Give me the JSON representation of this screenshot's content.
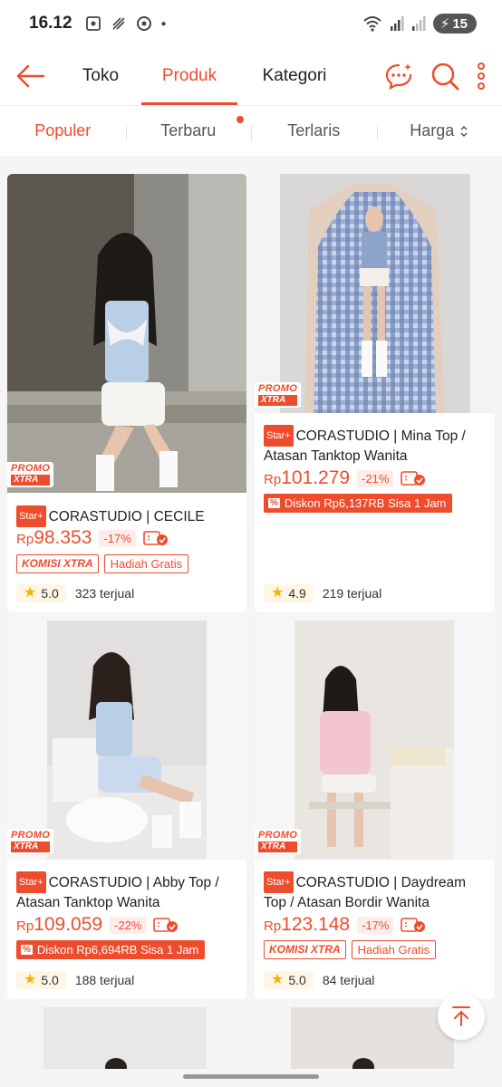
{
  "status_bar": {
    "time": "16.12",
    "battery": "15"
  },
  "header": {
    "tabs": [
      {
        "label": "Toko"
      },
      {
        "label": "Produk"
      },
      {
        "label": "Kategori"
      }
    ]
  },
  "sort_bar": {
    "items": [
      {
        "label": "Populer"
      },
      {
        "label": "Terbaru"
      },
      {
        "label": "Terlaris"
      },
      {
        "label": "Harga"
      }
    ]
  },
  "products": [
    {
      "badge": "Star+",
      "title": "CORASTUDIO | CECILE",
      "currency": "Rp",
      "price": "98.353",
      "discount": "-17%",
      "komisi": "KOMISI XTRA",
      "hadiah": "Hadiah Gratis",
      "rating": "5.0",
      "sold": "323 terjual",
      "promo_top": "PROMO",
      "promo_bottom": "XTRA"
    },
    {
      "badge": "Star+",
      "title": "CORASTUDIO | Mina Top / Atasan Tanktop Wanita",
      "currency": "Rp",
      "price": "101.279",
      "discount": "-21%",
      "diskon_label": "Diskon Rp6,137RB Sisa 1 Jam",
      "rating": "4.9",
      "sold": "219 terjual",
      "promo_top": "PROMO",
      "promo_bottom": "XTRA"
    },
    {
      "badge": "Star+",
      "title": "CORASTUDIO | Abby Top / Atasan Tanktop Wanita",
      "currency": "Rp",
      "price": "109.059",
      "discount": "-22%",
      "diskon_label": "Diskon Rp6,694RB Sisa 1 Jam",
      "rating": "5.0",
      "sold": "188 terjual",
      "promo_top": "PROMO",
      "promo_bottom": "XTRA"
    },
    {
      "badge": "Star+",
      "title": "CORASTUDIO | Daydream Top / Atasan Bordir Wanita",
      "currency": "Rp",
      "price": "123.148",
      "discount": "-17%",
      "komisi": "KOMISI XTRA",
      "hadiah": "Hadiah Gratis",
      "rating": "5.0",
      "sold": "84 terjual",
      "promo_top": "PROMO",
      "promo_bottom": "XTRA"
    }
  ],
  "colors": {
    "accent": "#ee4d2d",
    "star": "#f5b400"
  }
}
